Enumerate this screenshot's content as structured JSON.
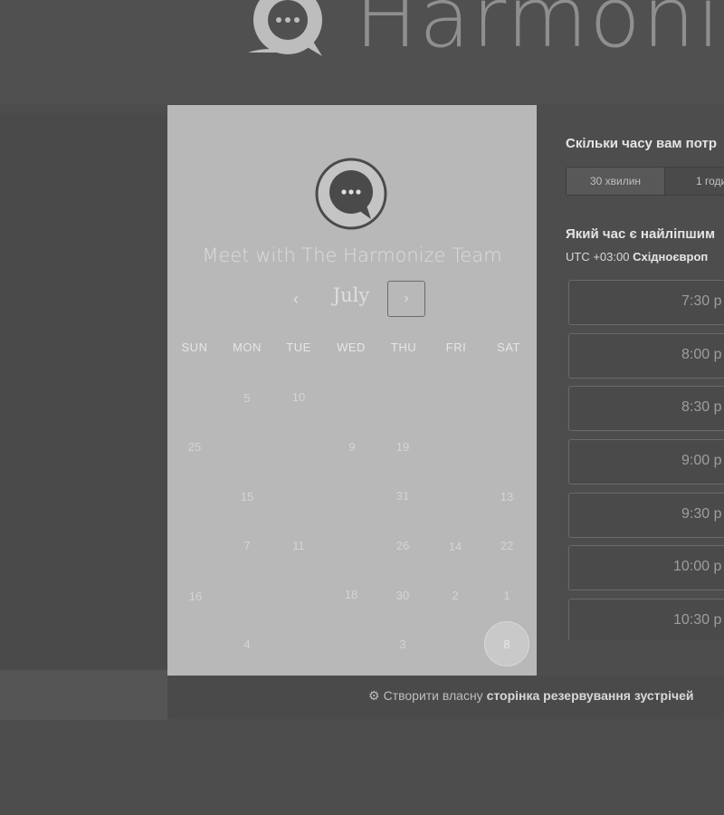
{
  "header": {
    "brand": "Harmoni"
  },
  "calendar": {
    "title": "Meet with The Harmonize Team",
    "month": "July",
    "prev_icon": "‹",
    "next_icon": "›",
    "weekdays": [
      "SUN",
      "MON",
      "TUE",
      "WED",
      "THU",
      "FRI",
      "SAT"
    ],
    "days": [
      "5",
      "10",
      "25",
      "9",
      "19",
      "15",
      "31",
      "13",
      "7",
      "11",
      "26",
      "14",
      "22",
      "16",
      "18",
      "30",
      "2",
      "1",
      "4",
      "3",
      "8"
    ],
    "selected_day": "8"
  },
  "booking": {
    "duration_question": "Скільки часу вам потр",
    "durations": [
      "30 хвилин",
      "1 годи"
    ],
    "time_question": "Який час є найліпшим",
    "timezone_prefix": "UTC +03:00",
    "timezone_name": "Східноєвроп",
    "slots": [
      "7:30 р",
      "8:00 р",
      "8:30 р",
      "9:00 р",
      "9:30 р",
      "10:00 р",
      "10:30 р"
    ]
  },
  "footer": {
    "icon": "hubspot-sprocket-icon",
    "text_plain": "Створити власну",
    "text_bold": "сторінка резервування зустрічей"
  }
}
